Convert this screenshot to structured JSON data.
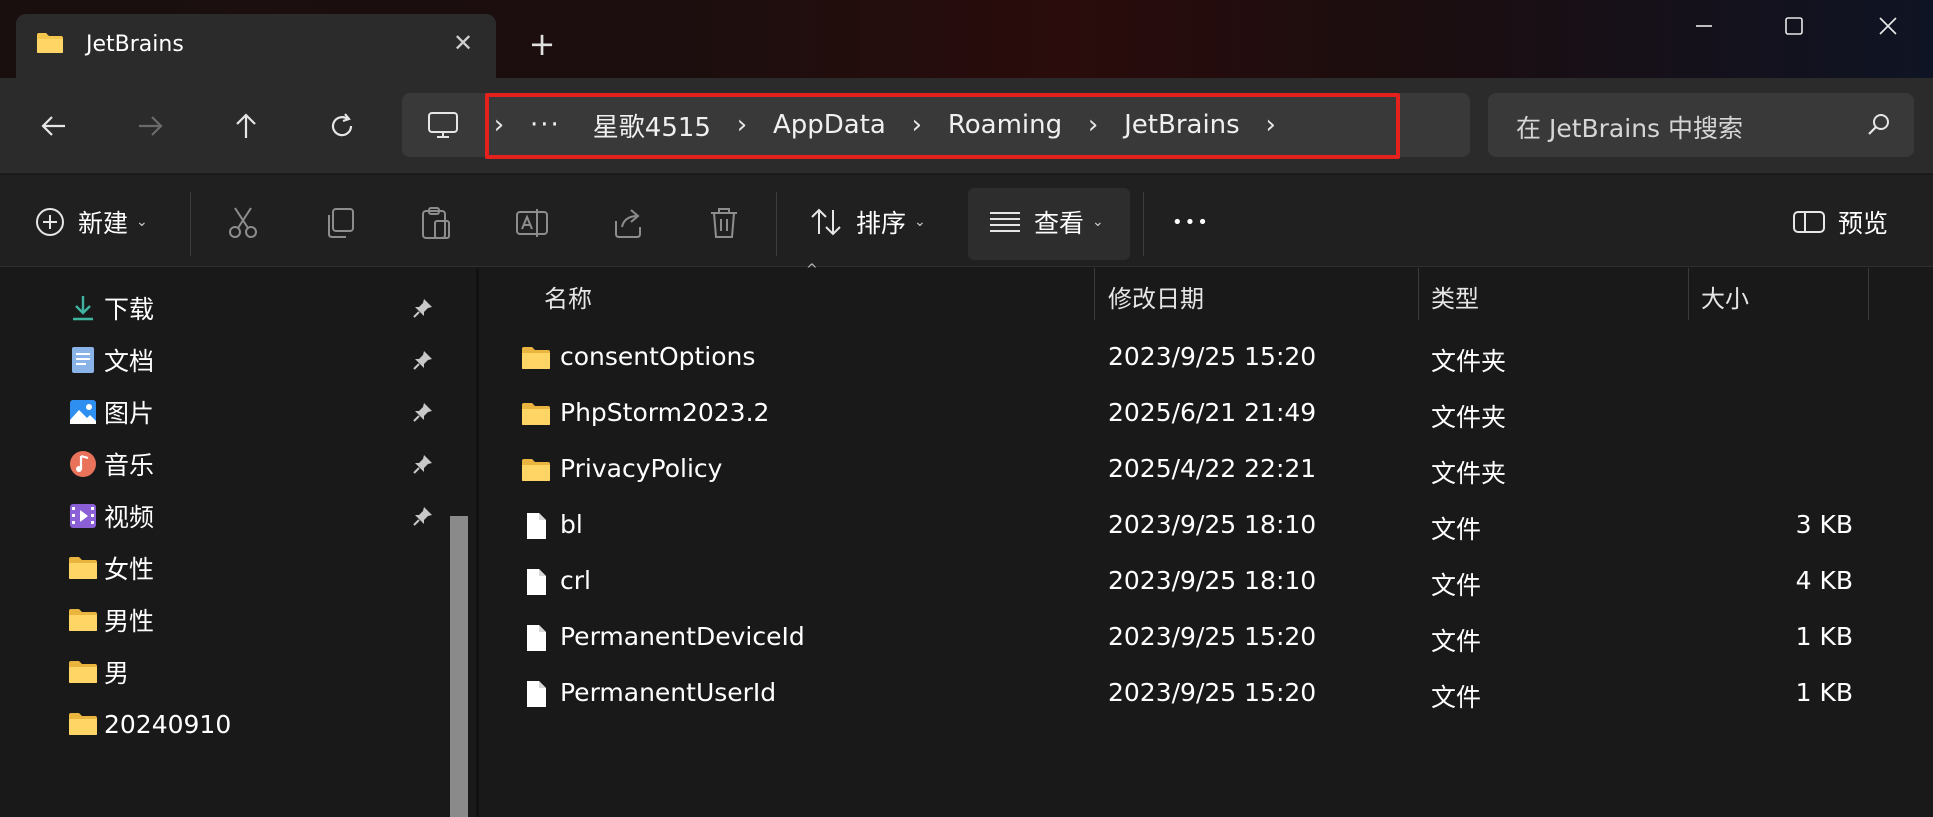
{
  "window": {
    "tab_title": "JetBrains",
    "tab_close_glyph": "✕",
    "new_tab_glyph": "+"
  },
  "address_bar": {
    "overflow_dots": "···",
    "crumbs": [
      "星歌4515",
      "AppData",
      "Roaming",
      "JetBrains"
    ],
    "search_placeholder": "在 JetBrains 中搜索"
  },
  "command_bar": {
    "new_label": "新建",
    "sort_label": "排序",
    "view_label": "查看",
    "more_glyph": "•••",
    "preview_label": "预览"
  },
  "nav_pane": {
    "items": [
      {
        "label": "下载",
        "icon": "download-icon",
        "pinned": true
      },
      {
        "label": "文档",
        "icon": "documents-icon",
        "pinned": true
      },
      {
        "label": "图片",
        "icon": "pictures-icon",
        "pinned": true
      },
      {
        "label": "音乐",
        "icon": "music-icon",
        "pinned": true
      },
      {
        "label": "视频",
        "icon": "videos-icon",
        "pinned": true
      },
      {
        "label": "女性",
        "icon": "folder-icon",
        "pinned": false
      },
      {
        "label": "男性",
        "icon": "folder-icon",
        "pinned": false
      },
      {
        "label": "男",
        "icon": "folder-icon",
        "pinned": false
      },
      {
        "label": "20240910",
        "icon": "folder-icon",
        "pinned": false
      }
    ]
  },
  "file_list": {
    "columns": {
      "name": "名称",
      "modified": "修改日期",
      "type": "类型",
      "size": "大小"
    },
    "rows": [
      {
        "name": "consentOptions",
        "modified": "2023/9/25 15:20",
        "type": "文件夹",
        "size": "",
        "icon": "folder-icon"
      },
      {
        "name": "PhpStorm2023.2",
        "modified": "2025/6/21 21:49",
        "type": "文件夹",
        "size": "",
        "icon": "folder-icon"
      },
      {
        "name": "PrivacyPolicy",
        "modified": "2025/4/22 22:21",
        "type": "文件夹",
        "size": "",
        "icon": "folder-icon"
      },
      {
        "name": "bl",
        "modified": "2023/9/25 18:10",
        "type": "文件",
        "size": "3 KB",
        "icon": "file-icon"
      },
      {
        "name": "crl",
        "modified": "2023/9/25 18:10",
        "type": "文件",
        "size": "4 KB",
        "icon": "file-icon"
      },
      {
        "name": "PermanentDeviceId",
        "modified": "2023/9/25 15:20",
        "type": "文件",
        "size": "1 KB",
        "icon": "file-icon"
      },
      {
        "name": "PermanentUserId",
        "modified": "2023/9/25 15:20",
        "type": "文件",
        "size": "1 KB",
        "icon": "file-icon"
      }
    ]
  },
  "colors": {
    "highlight_box": "#e5211d",
    "folder_yellow": "#f4c64c",
    "background": "#191919"
  }
}
